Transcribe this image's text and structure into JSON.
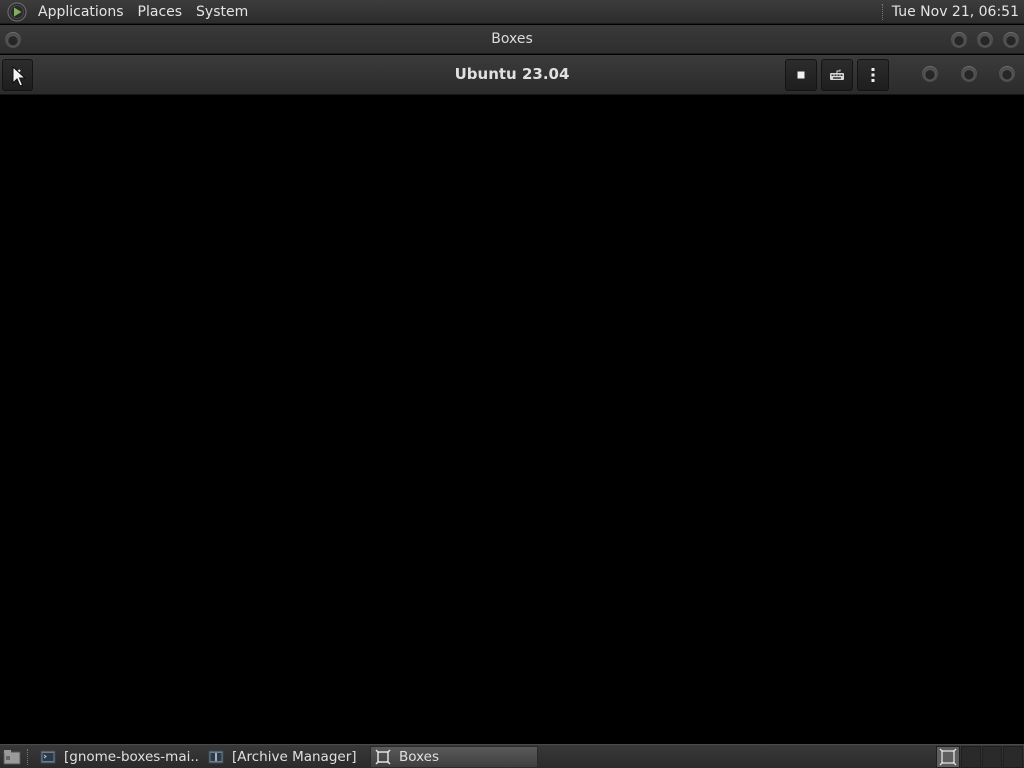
{
  "top_panel": {
    "menus": [
      "Applications",
      "Places",
      "System"
    ],
    "clock": "Tue Nov 21, 06:51"
  },
  "window": {
    "title": "Boxes"
  },
  "headerbar": {
    "title": "Ubuntu 23.04",
    "buttons": [
      "back-icon",
      "stop-icon",
      "keyboard-icon",
      "more-vertical-icon"
    ]
  },
  "taskbar": {
    "tasks": [
      {
        "label": "[gnome-boxes-mai...",
        "icon": "terminal-icon",
        "active": false
      },
      {
        "label": "[Archive Manager]",
        "icon": "archive-icon",
        "active": false
      },
      {
        "label": "Boxes",
        "icon": "boxes-icon",
        "active": true
      }
    ]
  },
  "colors": {
    "panel": "#2e2e2e",
    "display_background": "#000000",
    "text": "#e4e4e4"
  }
}
